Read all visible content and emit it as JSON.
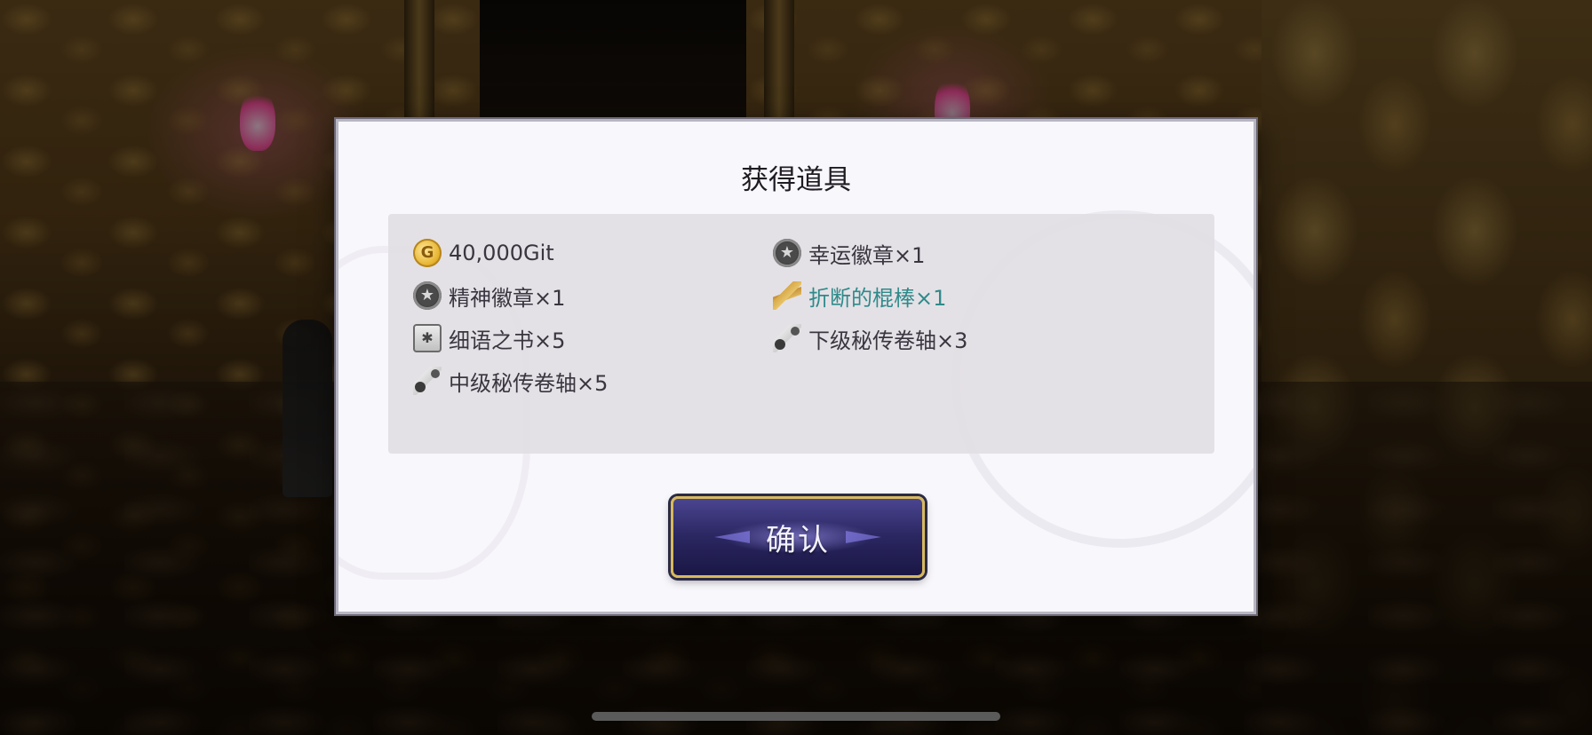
{
  "dialog": {
    "title": "获得道具",
    "confirm_label": "确认"
  },
  "items": [
    {
      "label": "40,000Git",
      "icon": "gold-coin-icon"
    },
    {
      "label": "幸运徽章×1",
      "icon": "badge-icon"
    },
    {
      "label": "精神徽章×1",
      "icon": "badge-icon"
    },
    {
      "label": "折断的棍棒×1",
      "icon": "broken-stick-icon",
      "highlight_color": "#2f8a8a"
    },
    {
      "label": "细语之书×5",
      "icon": "book-icon"
    },
    {
      "label": "下级秘传卷轴×3",
      "icon": "scroll-icon"
    },
    {
      "label": "中级秘传卷轴×5",
      "icon": "scroll-icon"
    }
  ],
  "colors": {
    "button_border": "#d6b95e",
    "button_fill": "#2a2660",
    "highlight_text": "#2f8a8a"
  }
}
